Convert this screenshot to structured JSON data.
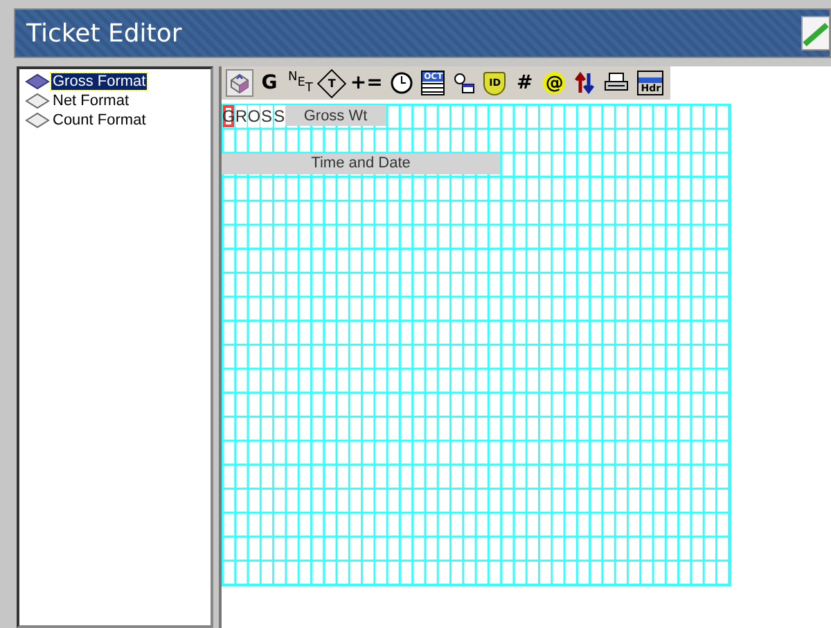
{
  "window": {
    "title": "Ticket Editor"
  },
  "formats": [
    {
      "label": "Gross Format",
      "selected": true
    },
    {
      "label": "Net Format",
      "selected": false
    },
    {
      "label": "Count Format",
      "selected": false
    }
  ],
  "toolbar": [
    {
      "kind": "cube",
      "selected": true
    },
    {
      "kind": "text",
      "label": "G",
      "selected": false
    },
    {
      "kind": "stagger",
      "label": "NET",
      "selected": false
    },
    {
      "kind": "diamond",
      "label": "T",
      "selected": false
    },
    {
      "kind": "text",
      "label": "+=",
      "selected": false
    },
    {
      "kind": "clock",
      "selected": false
    },
    {
      "kind": "calendar",
      "label": "OCT",
      "selected": false
    },
    {
      "kind": "timer",
      "selected": false
    },
    {
      "kind": "shield",
      "label": "ID",
      "selected": false
    },
    {
      "kind": "text",
      "label": "#",
      "selected": false
    },
    {
      "kind": "at",
      "label": "@",
      "selected": false
    },
    {
      "kind": "arrows",
      "selected": false
    },
    {
      "kind": "printer",
      "selected": false
    },
    {
      "kind": "header",
      "label": "Hdr",
      "selected": false
    }
  ],
  "grid_items": [
    {
      "kind": "char",
      "text": "G",
      "selected": true
    },
    {
      "kind": "char",
      "text": "R",
      "selected": false
    },
    {
      "kind": "char",
      "text": "O",
      "selected": false
    },
    {
      "kind": "char",
      "text": "S",
      "selected": false
    },
    {
      "kind": "char",
      "text": "S",
      "selected": false
    },
    {
      "kind": "field",
      "text": "Gross Wt",
      "selected": false
    },
    {
      "kind": "field",
      "text": "Time and Date",
      "selected": false
    }
  ]
}
